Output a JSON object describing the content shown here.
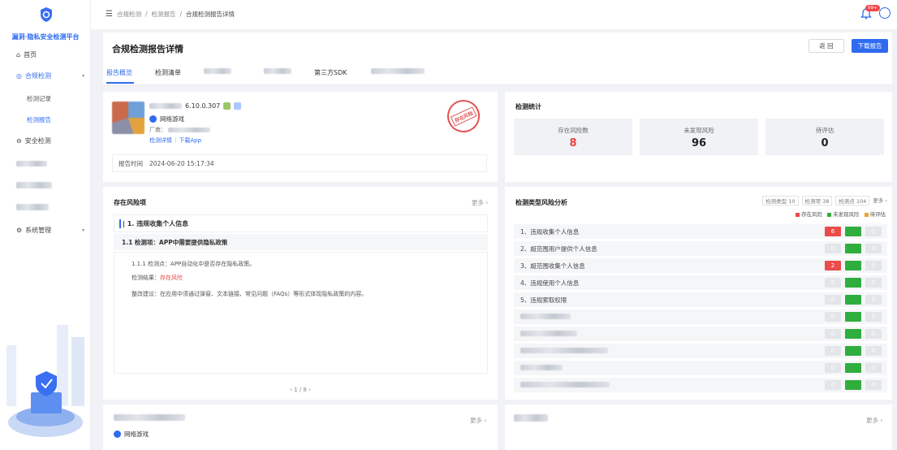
{
  "sidebar": {
    "title": "漏洞·隐私安全检测平台",
    "items": [
      {
        "label": "首页",
        "icon": "home-icon"
      },
      {
        "label": "合规检测",
        "icon": "shield-check-icon",
        "active": true
      },
      {
        "label": "检测记录"
      },
      {
        "label": "检测报告",
        "active": true
      },
      {
        "label": "安全检测",
        "icon": "shield-icon"
      },
      {
        "label": "系统管理",
        "icon": "gear-icon"
      }
    ]
  },
  "topbar": {
    "breadcrumb": [
      "合规检测",
      "检测报告",
      "合规检测报告详情"
    ],
    "notif_badge": "99+"
  },
  "header": {
    "title": "合规检测报告详情",
    "back_label": "返 回",
    "download_label": "下载报告",
    "tabs": [
      "报告概览",
      "检测清单",
      "第三方SDK"
    ]
  },
  "app_info": {
    "version": "6.10.0.307",
    "category": "网络游戏",
    "vendor_prefix": "厂商：",
    "detail_link": "检测详情",
    "download_link": "下载App",
    "stamp": "存在风险",
    "report_time_label": "报告时间",
    "report_time": "2024-06-20 15:17:34"
  },
  "stats": {
    "title": "检测统计",
    "items": [
      {
        "label": "存在风险数",
        "value": "8",
        "color": "#e84343"
      },
      {
        "label": "未发现风险",
        "value": "96",
        "color": "#222222"
      },
      {
        "label": "待评估",
        "value": "0",
        "color": "#222222"
      }
    ]
  },
  "risks": {
    "title": "存在风险项",
    "more": "更多 ›",
    "section": "| 1. 违规收集个人信息",
    "item": "1.1 检测项：APP中需要提供隐私政策",
    "point": "1.1.1 检测点：APP自动化中是否存在隐私政策。",
    "result_label": "检测结果：",
    "result_value": "存在风险",
    "advice": "整改建议：在应用中须通过弹窗、文本链接、常见问题（FAQs）等形式体现隐私政策的内容。",
    "pager": "‹  1 / 8  ›"
  },
  "analysis": {
    "title": "检测类型风险分析",
    "summary": [
      "检测类型 10",
      "检测项 38",
      "检测点 104"
    ],
    "more": "更多 ›",
    "legend": [
      {
        "label": "存在风险",
        "color": "#ea4b4b"
      },
      {
        "label": "未发现风险",
        "color": "#2fae3e"
      },
      {
        "label": "待评估",
        "color": "#f0a030"
      }
    ],
    "rows": [
      {
        "label": "1、违规收集个人信息",
        "risk": "6",
        "risky": true
      },
      {
        "label": "2、超范围用户提供个人信息",
        "risk": "0",
        "risky": false
      },
      {
        "label": "3、超范围收集个人信息",
        "risk": "2",
        "risky": true
      },
      {
        "label": "4、违规使用个人信息",
        "risk": "0",
        "risky": false
      },
      {
        "label": "5、违规索取权限",
        "risk": "0",
        "risky": false
      },
      {
        "label": "",
        "risk": "0",
        "risky": false
      },
      {
        "label": "",
        "risk": "0",
        "risky": false
      },
      {
        "label": "",
        "risk": "0",
        "risky": false
      },
      {
        "label": "",
        "risk": "0",
        "risky": false
      },
      {
        "label": "",
        "risk": "0",
        "risky": false
      }
    ],
    "zero": "0"
  },
  "bottom": {
    "more_left": "更多 ›",
    "more_right": "更多 ›",
    "category": "网络游戏"
  }
}
